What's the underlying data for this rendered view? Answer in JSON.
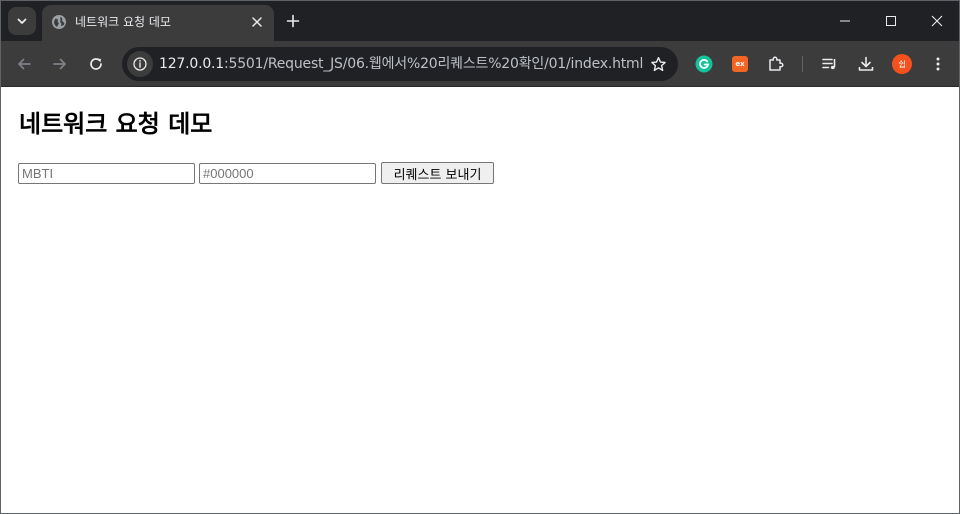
{
  "browser": {
    "tab": {
      "title": "네트워크 요청 데모",
      "favicon": "globe-icon"
    },
    "address_bar": {
      "url_host": "127.0.0.1",
      "url_rest": ":5501/Request_JS/06.웹에서%20리퀘스트%20확인/01/index.html"
    },
    "extensions": {
      "ext_badge": "ex",
      "profile_initial": "쉽"
    }
  },
  "page": {
    "heading": "네트워크 요청 데모",
    "inputs": [
      {
        "name": "mbti",
        "value": "",
        "placeholder": "MBTI"
      },
      {
        "name": "color",
        "value": "",
        "placeholder": "#000000"
      }
    ],
    "send_button": "리퀘스트 보내기"
  },
  "colors": {
    "titlebar": "#202124",
    "toolbar": "#3c3c3c",
    "omnibox": "#202124",
    "text_light": "#e8eaed",
    "grammarly": "#15c39a",
    "ext_orange": "#f26522",
    "profile": "#f4511e"
  }
}
